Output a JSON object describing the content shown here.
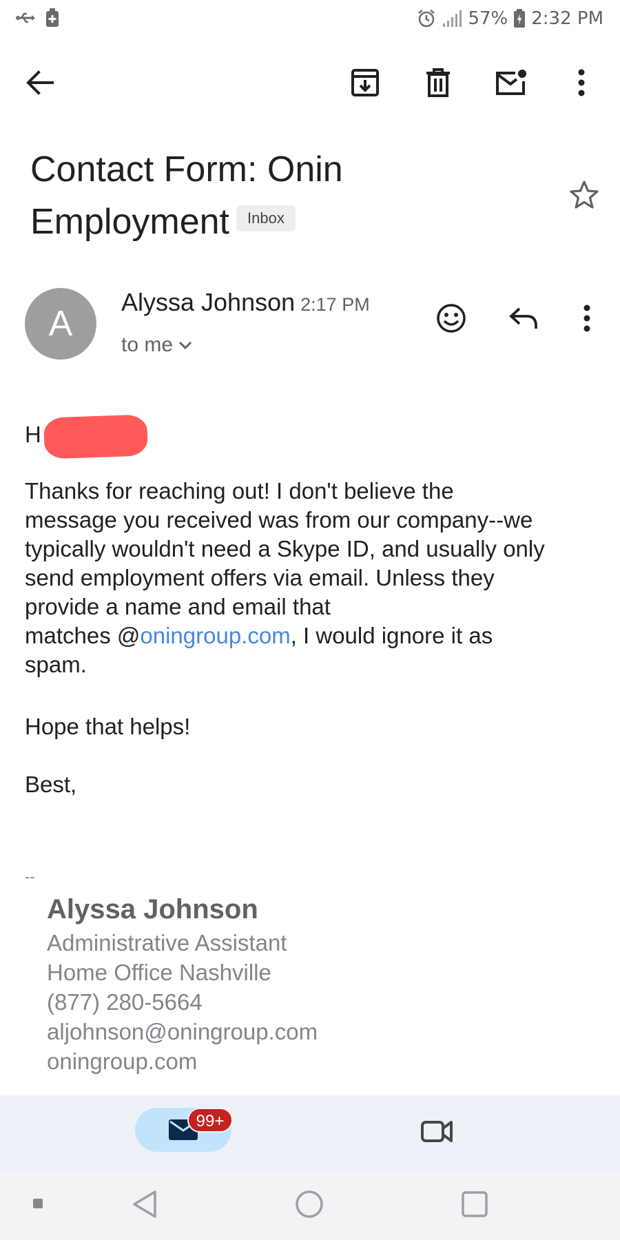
{
  "status_bar": {
    "battery_percent": "57%",
    "time": "2:32 PM"
  },
  "toolbar": {
    "back_icon": "arrow-left-icon",
    "archive_icon": "archive-icon",
    "delete_icon": "trash-icon",
    "mark_unread_icon": "mail-unread-icon",
    "more_icon": "more-vert-icon"
  },
  "subject": {
    "line1": "Contact Form: Onin",
    "line2": "Employment",
    "label": "Inbox"
  },
  "sender": {
    "initial": "A",
    "name": "Alyssa Johnson",
    "time": "2:17 PM",
    "to": "to me"
  },
  "body": {
    "greeting": "H",
    "p1": [
      "Thanks for reaching out! I don't believe the",
      "message you received was from our company--we",
      "typically wouldn't need a Skype ID, and usually only",
      "send employment offers via email. Unless they",
      "provide a name and email that"
    ],
    "p1_line6_before": "matches @",
    "p1_link": "oningroup.com",
    "p1_line6_after": ", I would ignore it as",
    "p1_line7": "spam.",
    "p2": "Hope that helps!",
    "p3": "Best,",
    "sig_sep": "--"
  },
  "signature": {
    "name": "Alyssa Johnson",
    "title": "Administrative Assistant",
    "office": "Home Office Nashville",
    "phone": "(877) 280-5664",
    "email": "aljohnson@oningroup.com",
    "website": "oningroup.com"
  },
  "bottom_tabs": {
    "mail_badge": "99+"
  },
  "colors": {
    "link": "#4a86e0",
    "badge": "#c5221f",
    "redaction": "#ff5a5a"
  }
}
